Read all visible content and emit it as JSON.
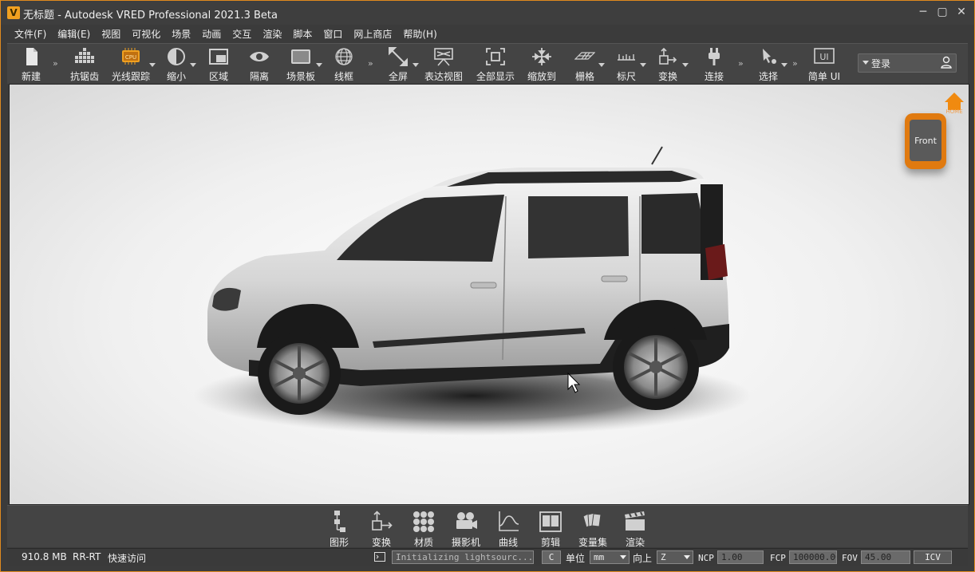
{
  "window": {
    "title": "无标题 - Autodesk VRED Professional 2021.3 Beta",
    "app_icon_letter": "V",
    "accent_color": "#e08a1e"
  },
  "menu": [
    {
      "label": "文件(F)"
    },
    {
      "label": "编辑(E)"
    },
    {
      "label": "视图"
    },
    {
      "label": "可视化"
    },
    {
      "label": "场景"
    },
    {
      "label": "动画"
    },
    {
      "label": "交互"
    },
    {
      "label": "渲染"
    },
    {
      "label": "脚本"
    },
    {
      "label": "窗口"
    },
    {
      "label": "网上商店"
    },
    {
      "label": "帮助(H)"
    }
  ],
  "toolbar": [
    {
      "label": "新建",
      "icon": "new-file-icon"
    },
    {
      "label": "抗锯齿",
      "icon": "antialias-icon"
    },
    {
      "label": "光线跟踪",
      "icon": "cpu-raytrace-icon",
      "badge": "CPU"
    },
    {
      "label": "缩小",
      "icon": "half-circle-icon"
    },
    {
      "label": "区域",
      "icon": "region-icon"
    },
    {
      "label": "隔离",
      "icon": "eye-icon"
    },
    {
      "label": "场景板",
      "icon": "sceneplate-icon"
    },
    {
      "label": "线框",
      "icon": "wireframe-sphere-icon"
    },
    {
      "label": "全屏",
      "icon": "fullscreen-icon"
    },
    {
      "label": "表达视图",
      "icon": "presentation-icon"
    },
    {
      "label": "全部显示",
      "icon": "show-all-icon"
    },
    {
      "label": "缩放到",
      "icon": "zoom-to-icon"
    },
    {
      "label": "栅格",
      "icon": "grid-icon"
    },
    {
      "label": "标尺",
      "icon": "ruler-icon"
    },
    {
      "label": "变换",
      "icon": "transform-icon"
    },
    {
      "label": "连接",
      "icon": "plug-icon"
    },
    {
      "label": "选择",
      "icon": "select-icon"
    },
    {
      "label": "简单 UI",
      "icon": "simple-ui-icon",
      "badge": "UI"
    }
  ],
  "login": {
    "label": "登录"
  },
  "viewport": {
    "navcube_face": "Front",
    "home_label": "HOME"
  },
  "bottom_toolbar": [
    {
      "label": "图形",
      "icon": "scenegraph-icon"
    },
    {
      "label": "变换",
      "icon": "transform-icon"
    },
    {
      "label": "材质",
      "icon": "materials-icon"
    },
    {
      "label": "摄影机",
      "icon": "camera-icon"
    },
    {
      "label": "曲线",
      "icon": "curves-icon"
    },
    {
      "label": "剪辑",
      "icon": "clips-icon"
    },
    {
      "label": "变量集",
      "icon": "variant-sets-icon"
    },
    {
      "label": "渲染",
      "icon": "render-clapper-icon"
    }
  ],
  "status": {
    "memory": "910.8 MB",
    "render_mode": "RR-RT",
    "quick_access": "快速访问",
    "message": "Initializing lightsourc...",
    "c_button": "C",
    "unit_label": "单位",
    "unit_value": "mm",
    "up_label": "向上",
    "up_value": "Z",
    "ncp_label": "NCP",
    "ncp_value": "1.00",
    "fcp_label": "FCP",
    "fcp_value": "100000.00",
    "fov_label": "FOV",
    "fov_value": "45.00",
    "icv_button": "ICV"
  }
}
